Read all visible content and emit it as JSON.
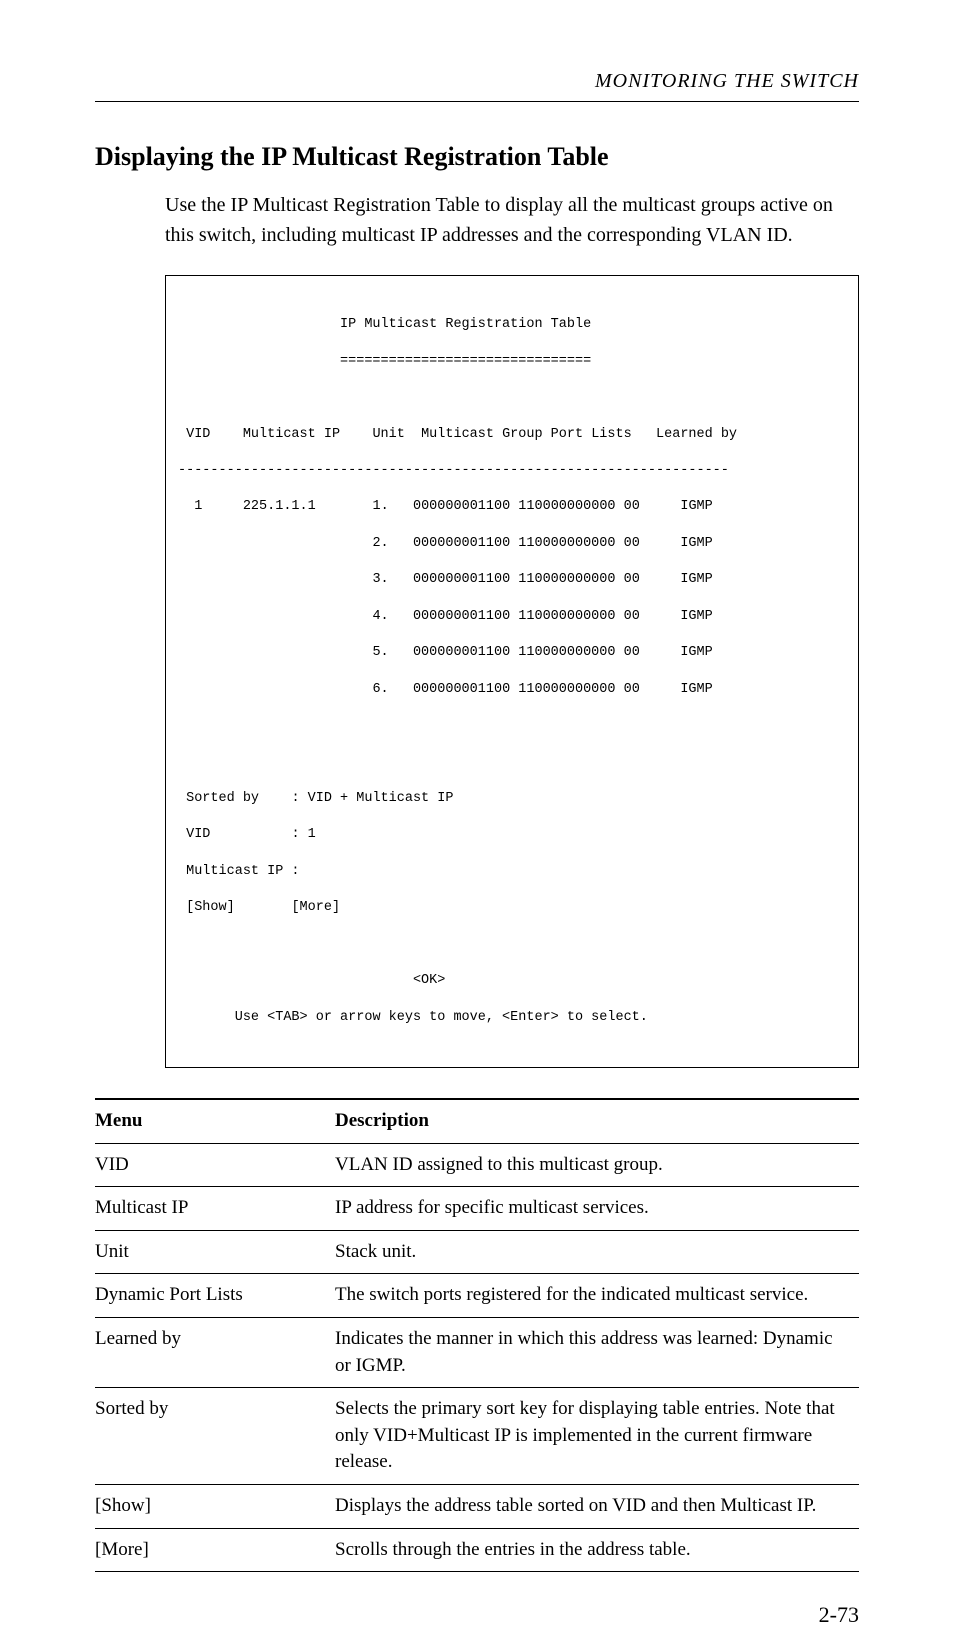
{
  "running_head": "MONITORING THE SWITCH",
  "section_heading": "Displaying the IP Multicast Registration Table",
  "intro_text": "Use the IP Multicast Registration Table to display all the multicast groups active on this switch, including multicast IP addresses and the corresponding VLAN ID.",
  "terminal": {
    "title": "IP Multicast Registration Table",
    "underline": "===============================",
    "header": {
      "vid": "VID",
      "multicast_ip": "Multicast IP",
      "unit": "Unit",
      "ports": "Multicast Group Port Lists",
      "learned": "Learned by"
    },
    "divider": "--------------------------------------------------------------------",
    "rows": [
      {
        "vid": "1",
        "mip": "225.1.1.1",
        "unit": "1.",
        "ports": "000000001100 110000000000 00",
        "learned": "IGMP"
      },
      {
        "vid": " ",
        "mip": " ",
        "unit": "2.",
        "ports": "000000001100 110000000000 00",
        "learned": "IGMP"
      },
      {
        "vid": " ",
        "mip": " ",
        "unit": "3.",
        "ports": "000000001100 110000000000 00",
        "learned": "IGMP"
      },
      {
        "vid": " ",
        "mip": " ",
        "unit": "4.",
        "ports": "000000001100 110000000000 00",
        "learned": "IGMP"
      },
      {
        "vid": " ",
        "mip": " ",
        "unit": "5.",
        "ports": "000000001100 110000000000 00",
        "learned": "IGMP"
      },
      {
        "vid": " ",
        "mip": " ",
        "unit": "6.",
        "ports": "000000001100 110000000000 00",
        "learned": "IGMP"
      }
    ],
    "sortedby_label": "Sorted by",
    "sortedby_value": ": VID + Multicast IP",
    "vid_label": "VID",
    "vid_value": ": 1",
    "multicastip_label": "Multicast IP :",
    "show_button": "[Show]",
    "more_button": "[More]",
    "ok_button": "<OK>",
    "footer_help": "Use <TAB> or arrow keys to move, <Enter> to select."
  },
  "table": {
    "head_menu": "Menu",
    "head_desc": "Description",
    "rows": [
      {
        "menu": "VID",
        "desc": "VLAN ID assigned to this multicast group."
      },
      {
        "menu": "Multicast IP",
        "desc": "IP address for specific multicast services."
      },
      {
        "menu": "Unit",
        "desc": "Stack unit."
      },
      {
        "menu": "Dynamic Port Lists",
        "desc": "The switch ports registered for the indicated multicast service."
      },
      {
        "menu": "Learned by",
        "desc": "Indicates the manner in which this address was learned: Dynamic or IGMP."
      },
      {
        "menu": "Sorted by",
        "desc": "Selects the primary sort key for displaying table entries. Note that only VID+Multicast IP is implemented in the current firmware release."
      },
      {
        "menu": "[Show]",
        "desc": "Displays the address table sorted on VID and then Multicast IP."
      },
      {
        "menu": "[More]",
        "desc": "Scrolls through the entries in the address table."
      }
    ]
  },
  "page_number": "2-73"
}
